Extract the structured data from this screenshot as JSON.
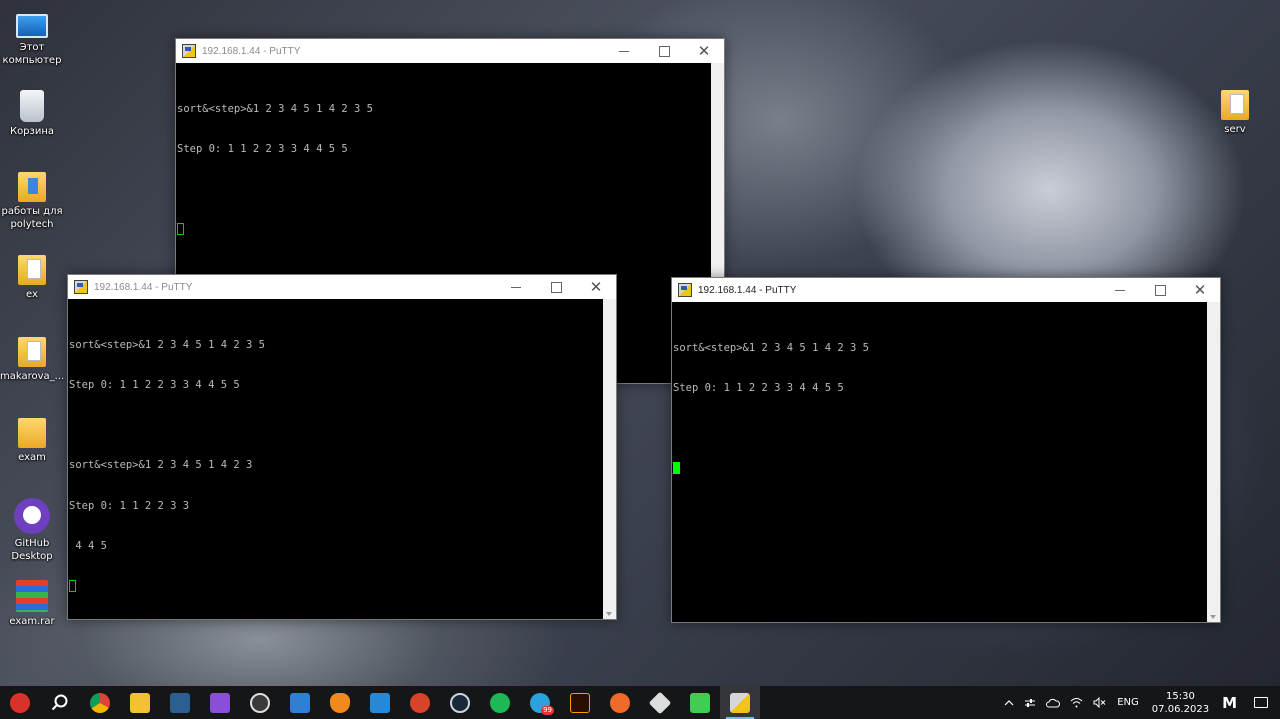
{
  "desktop": {
    "icons": [
      {
        "label": "Этот компьютер",
        "icon": "computer-icon"
      },
      {
        "label": "Корзина",
        "icon": "recycle-bin-icon"
      },
      {
        "label": "работы для polytech",
        "icon": "folder-icon"
      },
      {
        "label": "ex",
        "icon": "folder-icon"
      },
      {
        "label": "makarova_...",
        "icon": "folder-icon"
      },
      {
        "label": "exam",
        "icon": "folder-icon"
      },
      {
        "label": "GitHub Desktop",
        "icon": "github-desktop-icon"
      },
      {
        "label": "exam.rar",
        "icon": "winrar-archive-icon"
      },
      {
        "label": "serv",
        "icon": "folder-icon"
      }
    ]
  },
  "windows": [
    {
      "title": "192.168.1.44 - PuTTY",
      "lines": [
        "sort&<step>&1 2 3 4 5 1 4 2 3 5",
        "Step 0: 1 1 2 2 3 3 4 4 5 5",
        ""
      ]
    },
    {
      "title": "192.168.1.44 - PuTTY",
      "lines": [
        "sort&<step>&1 2 3 4 5 1 4 2 3 5",
        "Step 0: 1 1 2 2 3 3 4 4 5 5",
        "",
        "sort&<step>&1 2 3 4 5 1 4 2 3",
        "Step 0: 1 1 2 2 3 3",
        " 4 4 5"
      ]
    },
    {
      "title": "192.168.1.44 - PuTTY",
      "lines": [
        "sort&<step>&1 2 3 4 5 1 4 2 3 5",
        "Step 0: 1 1 2 2 3 3 4 4 5 5",
        ""
      ]
    }
  ],
  "taskbar": {
    "apps": [
      {
        "name": "angry-birds",
        "color": "#d8322a"
      },
      {
        "name": "search",
        "color": "#ffffff"
      },
      {
        "name": "chrome",
        "color": "#e5a42a"
      },
      {
        "name": "file-explorer",
        "color": "#f2c233"
      },
      {
        "name": "ssms",
        "color": "#2b5f8f"
      },
      {
        "name": "visual-studio",
        "color": "#8a4fd8"
      },
      {
        "name": "obs",
        "color": "#3a3a3a"
      },
      {
        "name": "store",
        "color": "#2f7fd6"
      },
      {
        "name": "fl-studio",
        "color": "#f08a1c"
      },
      {
        "name": "vscode",
        "color": "#2489d8"
      },
      {
        "name": "psiphon",
        "color": "#d8442a"
      },
      {
        "name": "steam",
        "color": "#1b2838"
      },
      {
        "name": "spotify",
        "color": "#1db954"
      },
      {
        "name": "telegram",
        "color": "#2aa3dd"
      },
      {
        "name": "illustrator",
        "color": "#2a0f00"
      },
      {
        "name": "sublime",
        "color": "#f06a2a"
      },
      {
        "name": "unity",
        "color": "#dddddd"
      },
      {
        "name": "qt-creator",
        "color": "#41cd52"
      },
      {
        "name": "putty",
        "color": "#2a5cb8"
      }
    ],
    "telegram_badge": "99",
    "language": "ENG",
    "time": "15:30",
    "date": "07.06.2023"
  }
}
